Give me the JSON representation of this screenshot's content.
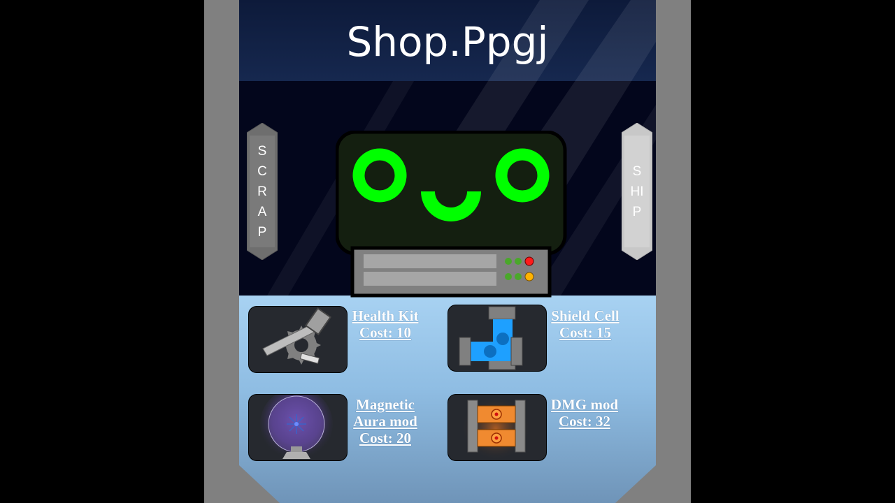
{
  "header": {
    "title": "Shop.Ppgj"
  },
  "side_buttons": {
    "left_label": "SCRAP",
    "right_label": "SHIP"
  },
  "items": [
    {
      "name": "Health Kit",
      "cost": "Cost: 10",
      "icon": "repair-saw-icon"
    },
    {
      "name": "Shield Cell",
      "cost": "Cost: 15",
      "icon": "shield-cell-icon"
    },
    {
      "name": "Magnetic Aura mod",
      "name_line1": "Magnetic",
      "name_line2": "Aura mod",
      "cost": "Cost: 20",
      "icon": "magnetic-orb-icon"
    },
    {
      "name": "DMG mod",
      "cost": "Cost: 32",
      "icon": "damage-core-icon"
    }
  ],
  "colors": {
    "frame": "#808080",
    "header_bg": "#0d1a3a",
    "robot_eyes": "#00ff00",
    "card_bg": "#26292f",
    "shop_bg": "#a8d2f2"
  }
}
